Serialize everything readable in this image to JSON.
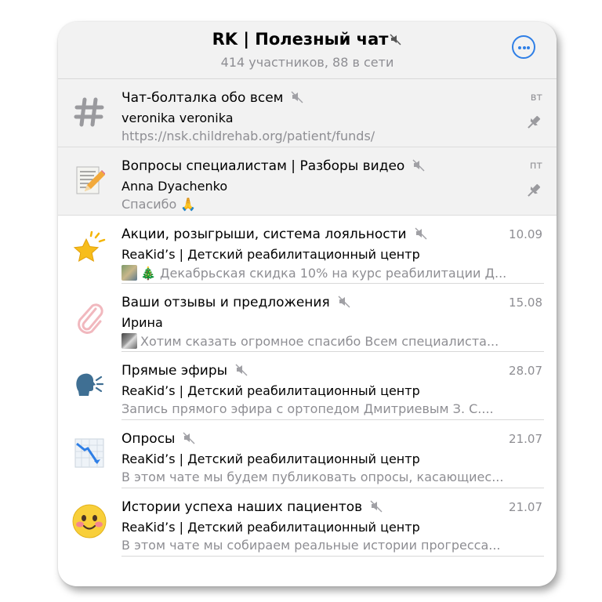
{
  "header": {
    "title": "RK | Полезный чат",
    "subtitle": "414 участников, 88 в сети",
    "more_icon": "ellipsis-circle-icon",
    "accent_color": "#2f7fe6"
  },
  "chats": [
    {
      "title": "Чат-болталка обо всем",
      "muted": true,
      "date": "вт",
      "pinned": true,
      "sender": "veronika veronika",
      "preview": "https://nsk.childrehab.org/patient/funds/",
      "avatar_icon": "hash-icon"
    },
    {
      "title": "Вопросы специалистам | Разборы видео",
      "muted": true,
      "date": "пт",
      "pinned": true,
      "sender": "Anna Dyachenko",
      "preview": "Спасибо 🙏",
      "avatar_icon": "memo-icon"
    },
    {
      "title": "Акции, розыгрыши, система лояльности",
      "muted": true,
      "date": "10.09",
      "pinned": false,
      "sender": "ReaKid’s | Детский реабилитационный центр",
      "preview": "🎄 Декабрьская скидка 10% на курс реабилитации Д...",
      "avatar_icon": "star-icon"
    },
    {
      "title": "Ваши отзывы и предложения",
      "muted": true,
      "date": "15.08",
      "pinned": false,
      "sender": "Ирина",
      "preview": "Хотим сказать огромное спасибо Всем специалиста...",
      "avatar_icon": "paperclip-icon"
    },
    {
      "title": "Прямые эфиры",
      "muted": true,
      "date": "28.07",
      "pinned": false,
      "sender": "ReaKid’s | Детский реабилитационный центр",
      "preview": "Запись прямого эфира с ортопедом Дмитриевым З. С....",
      "avatar_icon": "speaking-head-icon"
    },
    {
      "title": "Опросы",
      "muted": true,
      "date": "21.07",
      "pinned": false,
      "sender": "ReaKid’s | Детский реабилитационный центр",
      "preview": "В этом чате мы будем публиковать опросы, касающиес...",
      "avatar_icon": "chart-decreasing-icon"
    },
    {
      "title": "Истории успеха наших пациентов",
      "muted": true,
      "date": "21.07",
      "pinned": false,
      "sender": "ReaKid’s | Детский реабилитационный центр",
      "preview": "В этом чате мы собираем реальные истории прогресса...",
      "avatar_icon": "smiling-face-icon"
    }
  ]
}
